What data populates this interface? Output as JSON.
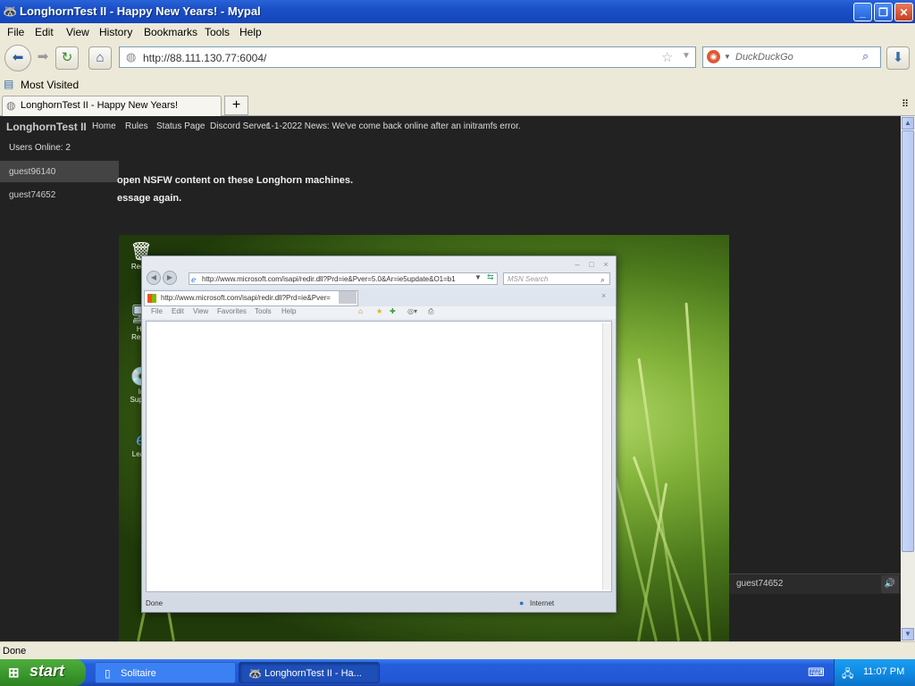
{
  "window": {
    "title": "LonghornTest II - Happy New Years! - Mypal",
    "controls": {
      "minimize": "_",
      "maximize": "❐",
      "close": "✕"
    }
  },
  "menu": [
    "File",
    "Edit",
    "View",
    "History",
    "Bookmarks",
    "Tools",
    "Help"
  ],
  "toolbar": {
    "url": "http://88.111.130.77:6004/",
    "search_placeholder": "DuckDuckGo"
  },
  "bookmarks": {
    "most_visited": "Most Visited"
  },
  "tab": {
    "title": "LonghornTest II - Happy New Years!",
    "new_tab": "+"
  },
  "site": {
    "brand": "LonghornTest II",
    "nav": [
      "Home",
      "Rules",
      "Status Page",
      "Discord Server",
      "1-1-2022 News: We've come back online after an initramfs error."
    ],
    "users_online": "Users Online: 2",
    "users": [
      "guest96140",
      "guest74652"
    ],
    "notice_line1": "open NSFW content on these Longhorn machines.",
    "notice_line2": "essage again.",
    "chat_user": "guest74652"
  },
  "remote_desktop": {
    "icons": [
      "Recyc",
      "Ho Repor",
      "In Supple",
      "Learn"
    ],
    "ie": {
      "address": "http://www.microsoft.com/isapi/redir.dll?Prd=ie&Pver=5.0&Ar=ie5update&O1=b1",
      "search_placeholder": "MSN Search",
      "tab_title": "http://www.microsoft.com/isapi/redir.dll?Prd=ie&Pver=",
      "menu": [
        "File",
        "Edit",
        "View",
        "Favorites",
        "Tools",
        "Help"
      ],
      "status_left": "Done",
      "status_zone": "Internet"
    }
  },
  "statusbar": {
    "text": "Done"
  },
  "taskbar": {
    "start": "start",
    "tasks": [
      "Solitaire",
      "LonghornTest II - Ha..."
    ],
    "clock": "11:07 PM"
  }
}
